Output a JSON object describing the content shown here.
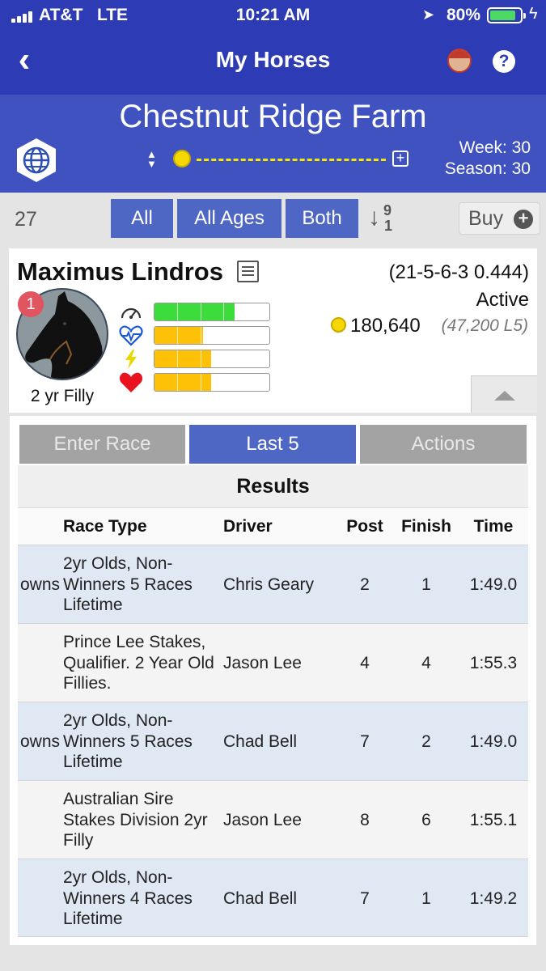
{
  "status_bar": {
    "carrier": "AT&T",
    "network": "LTE",
    "time": "10:21 AM",
    "battery": "80%"
  },
  "nav": {
    "title": "My Horses",
    "back_icon": "chevron-left-icon",
    "help_label": "?"
  },
  "farm": {
    "name": "Chestnut Ridge Farm",
    "week": "Week: 30",
    "season": "Season: 30",
    "plus": "+"
  },
  "filters": {
    "count": "27",
    "all": "All",
    "ages": "All Ages",
    "gender": "Both",
    "sort_top": "9",
    "sort_bottom": "1",
    "buy": "Buy",
    "buy_plus": "+"
  },
  "horse": {
    "name": "Maximus Lindros",
    "record": "(21-5-6-3 0.444)",
    "status": "Active",
    "earnings": "180,640",
    "last5": "(47,200 L5)",
    "rank": "1",
    "age": "2 yr Filly",
    "stats": [
      {
        "icon": "speedometer-icon",
        "level": 0.7,
        "color": "#3ddc3d"
      },
      {
        "icon": "heartbeat-icon",
        "level": 0.42,
        "color": "#ffc107"
      },
      {
        "icon": "lightning-icon",
        "level": 0.49,
        "color": "#ffc107"
      },
      {
        "icon": "heart-icon",
        "level": 0.49,
        "color": "#ffc107"
      }
    ]
  },
  "tabs": [
    {
      "label": "Enter Race",
      "active": false
    },
    {
      "label": "Last 5",
      "active": true
    },
    {
      "label": "Actions",
      "active": false
    }
  ],
  "results": {
    "title": "Results",
    "headers": {
      "race_type": "Race Type",
      "driver": "Driver",
      "post": "Post",
      "finish": "Finish",
      "time": "Time"
    },
    "rows": [
      {
        "cutoff": "owns",
        "race_type": "2yr Olds, Non-Winners 5 Races Lifetime",
        "driver": "Chris Geary",
        "post": "2",
        "finish": "1",
        "time": "1:49.0"
      },
      {
        "cutoff": "",
        "race_type": "Prince Lee Stakes, Qualifier. 2 Year Old Fillies.",
        "driver": "Jason Lee",
        "post": "4",
        "finish": "4",
        "time": "1:55.3"
      },
      {
        "cutoff": "owns",
        "race_type": "2yr Olds, Non-Winners 5 Races Lifetime",
        "driver": "Chad Bell",
        "post": "7",
        "finish": "2",
        "time": "1:49.0"
      },
      {
        "cutoff": "",
        "race_type": "Australian Sire Stakes Division 2yr Filly",
        "driver": "Jason Lee",
        "post": "8",
        "finish": "6",
        "time": "1:55.1"
      },
      {
        "cutoff": "",
        "race_type": "2yr Olds, Non-Winners 4 Races Lifetime",
        "driver": "Chad Bell",
        "post": "7",
        "finish": "1",
        "time": "1:49.2"
      }
    ]
  }
}
